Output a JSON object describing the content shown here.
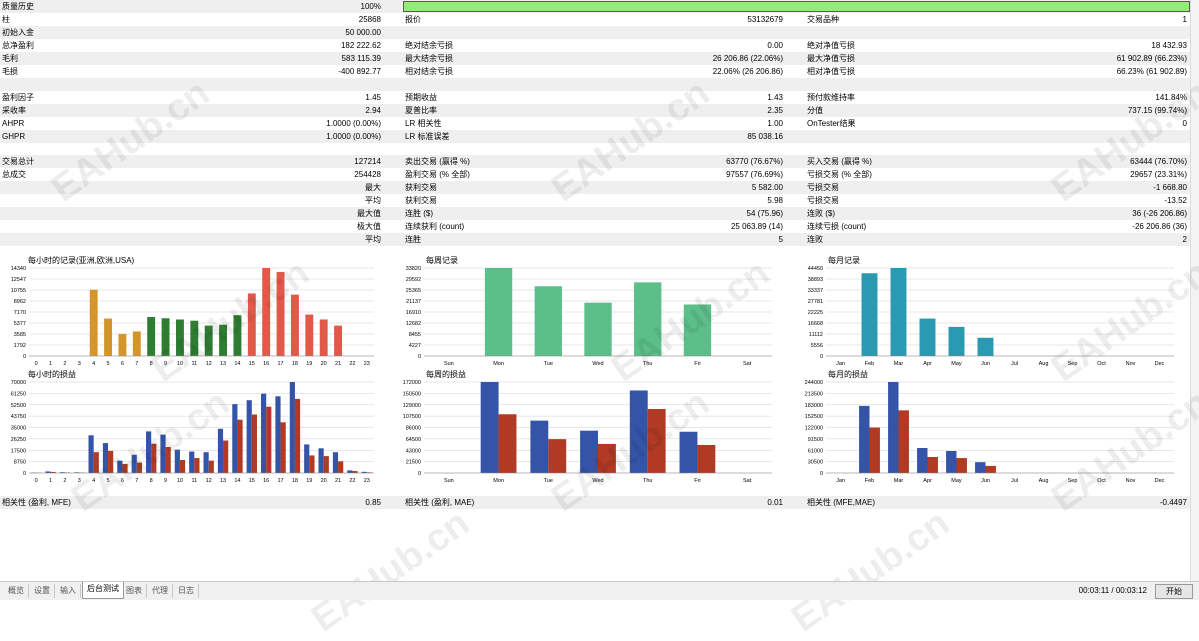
{
  "rows": [
    {
      "shade": true,
      "cells": [
        "质量历史",
        "100%",
        "",
        "",
        "",
        ""
      ]
    },
    {
      "shade": false,
      "cells": [
        "柱",
        "25868",
        "报价",
        "53132679",
        "交易品种",
        "1"
      ]
    },
    {
      "shade": true,
      "cells": [
        "初始入金",
        "50 000.00",
        "",
        "",
        "",
        ""
      ]
    },
    {
      "shade": false,
      "cells": [
        "总净盈利",
        "182 222.62",
        "绝对结余亏损",
        "0.00",
        "绝对净值亏损",
        "18 432.93"
      ]
    },
    {
      "shade": true,
      "cells": [
        "毛利",
        "583 115.39",
        "最大结余亏损",
        "26 206.86 (22.06%)",
        "最大净值亏损",
        "61 902.89 (66.23%)"
      ]
    },
    {
      "shade": false,
      "cells": [
        "毛损",
        "-400 892.77",
        "相对结余亏损",
        "22.06% (26 206.86)",
        "相对净值亏损",
        "66.23% (61 902.89)"
      ]
    },
    {
      "shade": true,
      "cells": [
        "",
        "",
        "",
        "",
        "",
        ""
      ]
    },
    {
      "shade": false,
      "cells": [
        "盈利因子",
        "1.45",
        "预期收益",
        "1.43",
        "预付款维持率",
        "141.84%"
      ]
    },
    {
      "shade": true,
      "cells": [
        "采收率",
        "2.94",
        "夏普比率",
        "2.35",
        "分值",
        "737.15 (99.74%)"
      ]
    },
    {
      "shade": false,
      "cells": [
        "AHPR",
        "1.0000 (0.00%)",
        "LR 相关性",
        "1.00",
        "OnTester结果",
        "0"
      ]
    },
    {
      "shade": true,
      "cells": [
        "GHPR",
        "1.0000 (0.00%)",
        "LR 标准误差",
        "85 038.16",
        "",
        ""
      ]
    },
    {
      "shade": false,
      "cells": [
        "",
        "",
        "",
        "",
        "",
        ""
      ]
    },
    {
      "shade": true,
      "cells": [
        "交易总计",
        "127214",
        "卖出交易 (赢得 %)",
        "63770 (76.67%)",
        "买入交易 (赢得 %)",
        "63444 (76.70%)"
      ]
    },
    {
      "shade": false,
      "cells": [
        "总成交",
        "254428",
        "盈利交易 (% 全部)",
        "97557 (76.69%)",
        "亏损交易 (% 全部)",
        "29657 (23.31%)"
      ]
    },
    {
      "shade": true,
      "cells": [
        "",
        "最大",
        "获利交易",
        "5 582.00",
        "亏损交易",
        "-1 668.80"
      ]
    },
    {
      "shade": false,
      "cells": [
        "",
        "平均",
        "获利交易",
        "5.98",
        "亏损交易",
        "-13.52"
      ]
    },
    {
      "shade": true,
      "cells": [
        "",
        "最大值",
        "连胜 ($)",
        "54 (75.96)",
        "连败 ($)",
        "36 (-26 206.86)"
      ]
    },
    {
      "shade": false,
      "cells": [
        "",
        "极大值",
        "连续获利 (count)",
        "25 063.89 (14)",
        "连续亏损 (count)",
        "-26 206.86 (36)"
      ]
    },
    {
      "shade": true,
      "cells": [
        "",
        "平均",
        "连胜",
        "5",
        "连败",
        "2"
      ]
    }
  ],
  "bottom_row": {
    "cells": [
      "相关性 (盈利, MFE)",
      "0.85",
      "相关性 (盈利, MAE)",
      "0.01",
      "相关性 (MFE,MAE)",
      "-0.4497"
    ]
  },
  "quality_fill": 1.0,
  "colors": {
    "orange": "#d4962a",
    "green": "#2e7d32",
    "red": "#e05a4a",
    "lightgreen_bar": "#90ee70",
    "blue": "#3454a8",
    "darkred": "#b03a24",
    "teal": "#2a9ab2",
    "mint": "#5cbf8a"
  },
  "chart_data": [
    {
      "type": "bar",
      "title": "每小时的记录(亚洲,欧洲,USA)",
      "categories": [
        "0",
        "1",
        "2",
        "3",
        "4",
        "5",
        "6",
        "7",
        "8",
        "9",
        "10",
        "11",
        "12",
        "13",
        "14",
        "15",
        "16",
        "17",
        "18",
        "19",
        "20",
        "21",
        "22",
        "23"
      ],
      "yticks": [
        "14340",
        "12547",
        "10755",
        "8962",
        "7170",
        "5377",
        "3585",
        "1792",
        "0"
      ],
      "ylim": [
        0,
        14340
      ],
      "series": [
        {
          "values": [
            0,
            0,
            0,
            0,
            10800,
            6100,
            3600,
            4000,
            6350,
            6150,
            5950,
            5750,
            4950,
            5100,
            6650,
            10200,
            14340,
            13700,
            10000,
            6750,
            5950,
            4950,
            0,
            0
          ],
          "colors": [
            "orange",
            "orange",
            "orange",
            "orange",
            "orange",
            "orange",
            "orange",
            "orange",
            "green",
            "green",
            "green",
            "green",
            "green",
            "green",
            "green",
            "red",
            "red",
            "red",
            "red",
            "red",
            "red",
            "red",
            "red",
            "red"
          ]
        }
      ]
    },
    {
      "type": "bar",
      "title": "每周记录",
      "categories": [
        "Sun",
        "Mon",
        "Tue",
        "Wed",
        "Thu",
        "Fri",
        "Sat"
      ],
      "yticks": [
        "33820",
        "29592",
        "25365",
        "21137",
        "16910",
        "12682",
        "8455",
        "4227",
        "0"
      ],
      "ylim": [
        0,
        33820
      ],
      "series": [
        {
          "values": [
            0,
            33820,
            26800,
            20500,
            28300,
            19800,
            0
          ],
          "colors": [
            "mint",
            "mint",
            "mint",
            "mint",
            "mint",
            "mint",
            "mint"
          ]
        }
      ]
    },
    {
      "type": "bar",
      "title": "每月记录",
      "categories": [
        "Jan",
        "Feb",
        "Mar",
        "Apr",
        "May",
        "Jun",
        "Jul",
        "Aug",
        "Sep",
        "Oct",
        "Nov",
        "Dec"
      ],
      "yticks": [
        "44450",
        "38893",
        "33337",
        "27781",
        "22225",
        "16668",
        "11112",
        "5556",
        "0"
      ],
      "ylim": [
        0,
        44450
      ],
      "series": [
        {
          "values": [
            0,
            41800,
            44450,
            18900,
            14700,
            9200,
            0,
            0,
            0,
            0,
            0,
            0
          ],
          "colors": [
            "teal",
            "teal",
            "teal",
            "teal",
            "teal",
            "teal",
            "teal",
            "teal",
            "teal",
            "teal",
            "teal",
            "teal"
          ]
        }
      ]
    },
    {
      "type": "bar",
      "title": "每小时的损益",
      "categories": [
        "0",
        "1",
        "2",
        "3",
        "4",
        "5",
        "6",
        "7",
        "8",
        "9",
        "10",
        "11",
        "12",
        "13",
        "14",
        "15",
        "16",
        "17",
        "18",
        "19",
        "20",
        "21",
        "22",
        "23"
      ],
      "yticks": [
        "70000",
        "61250",
        "52500",
        "43750",
        "35000",
        "26250",
        "17500",
        "8750",
        "0"
      ],
      "ylim": [
        0,
        70000
      ],
      "series": [
        {
          "name": "",
          "values": [
            300,
            1200,
            600,
            500,
            29000,
            23000,
            9500,
            14000,
            32000,
            29500,
            18000,
            16500,
            16000,
            34000,
            53000,
            56000,
            61000,
            59000,
            70000,
            22000,
            19000,
            16000,
            2000,
            900
          ],
          "color": "blue"
        },
        {
          "name": "",
          "values": [
            200,
            800,
            400,
            300,
            16000,
            17000,
            7000,
            8000,
            22500,
            20000,
            10000,
            11500,
            9500,
            25000,
            41000,
            45000,
            51000,
            39000,
            57000,
            13500,
            13000,
            9000,
            1500,
            500
          ],
          "color": "darkred"
        }
      ]
    },
    {
      "type": "bar",
      "title": "每周的损益",
      "categories": [
        "Sun",
        "Mon",
        "Tue",
        "Wed",
        "Thu",
        "Fri",
        "Sat"
      ],
      "yticks": [
        "172000",
        "150500",
        "129000",
        "107500",
        "86000",
        "64500",
        "43000",
        "21500",
        "0"
      ],
      "ylim": [
        0,
        172000
      ],
      "series": [
        {
          "name": "",
          "values": [
            0,
            172000,
            99000,
            80000,
            156000,
            78000,
            0
          ],
          "color": "blue"
        },
        {
          "name": "",
          "values": [
            0,
            111000,
            64000,
            55000,
            121000,
            53000,
            0
          ],
          "color": "darkred"
        }
      ]
    },
    {
      "type": "bar",
      "title": "每月的损益",
      "categories": [
        "Jan",
        "Feb",
        "Mar",
        "Apr",
        "May",
        "Jun",
        "Jul",
        "Aug",
        "Sep",
        "Oct",
        "Nov",
        "Dec"
      ],
      "yticks": [
        "244000",
        "213500",
        "183000",
        "152500",
        "122000",
        "91500",
        "61000",
        "30500",
        "0"
      ],
      "ylim": [
        0,
        244000
      ],
      "series": [
        {
          "name": "",
          "values": [
            0,
            180000,
            244000,
            67000,
            59000,
            29000,
            0,
            0,
            0,
            0,
            0,
            0
          ],
          "color": "blue"
        },
        {
          "name": "",
          "values": [
            0,
            122000,
            168000,
            43000,
            40000,
            19000,
            0,
            0,
            0,
            0,
            0,
            0
          ],
          "color": "darkred"
        }
      ]
    }
  ],
  "tabs": [
    "概览",
    "设置",
    "输入",
    "后台测试",
    "图表",
    "代理",
    "日志"
  ],
  "active_tab": 3,
  "timer": "00:03:11 / 00:03:12",
  "start_label": "开始",
  "watermark": "EAHub.cn"
}
